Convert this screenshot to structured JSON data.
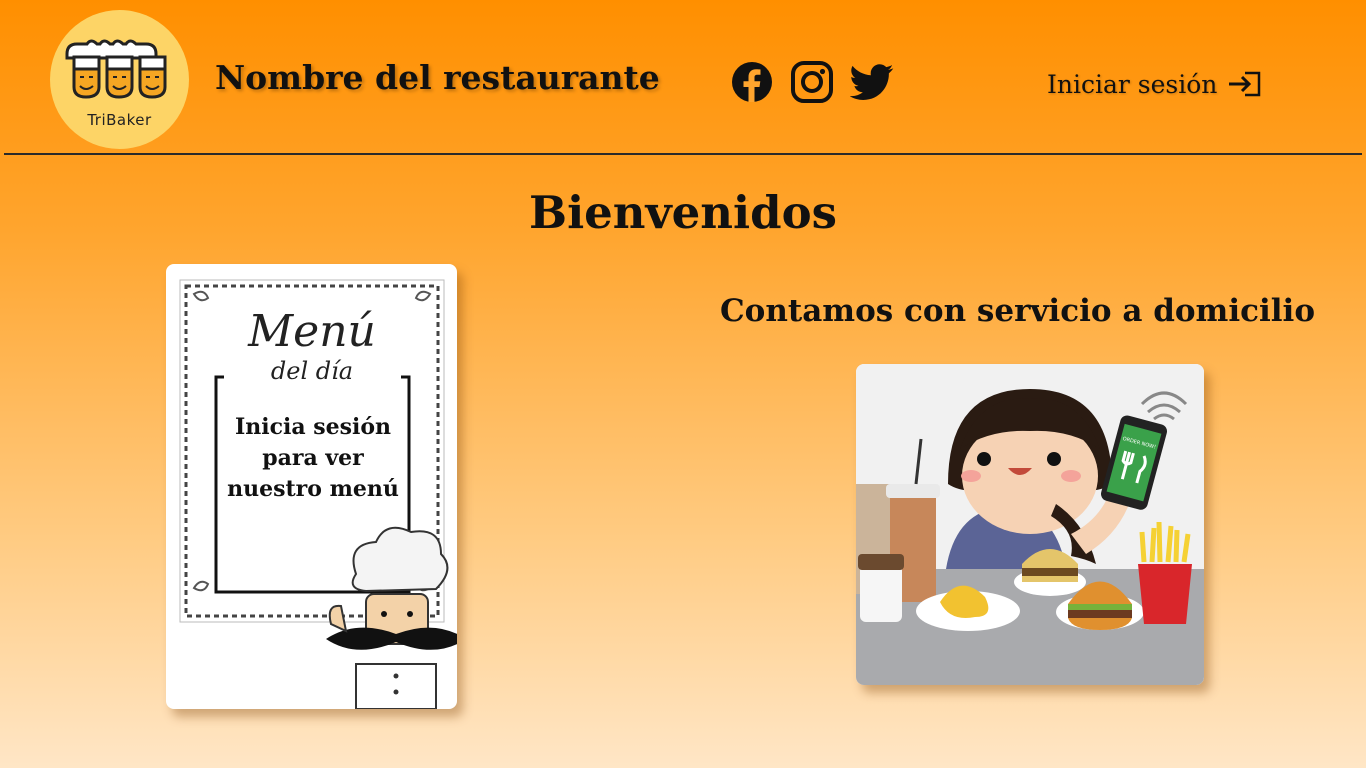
{
  "header": {
    "logo_text": "TriBaker",
    "restaurant_name": "Nombre del restaurante",
    "social": [
      {
        "name": "facebook-icon"
      },
      {
        "name": "instagram-icon"
      },
      {
        "name": "twitter-icon"
      }
    ],
    "login_label": "Iniciar sesión"
  },
  "main": {
    "welcome_title": "Bienvenidos",
    "menu_card": {
      "title": "Menú",
      "subtitle": "del día",
      "message": "Inicia sesión para ver nuestro menú"
    },
    "delivery": {
      "heading": "Contamos con servicio a domicilio",
      "phone_text": "ORDER NOW!"
    }
  },
  "colors": {
    "header_orange": "#ff8f00",
    "logo_yellow": "#fdd466",
    "text_dark": "#111111"
  }
}
